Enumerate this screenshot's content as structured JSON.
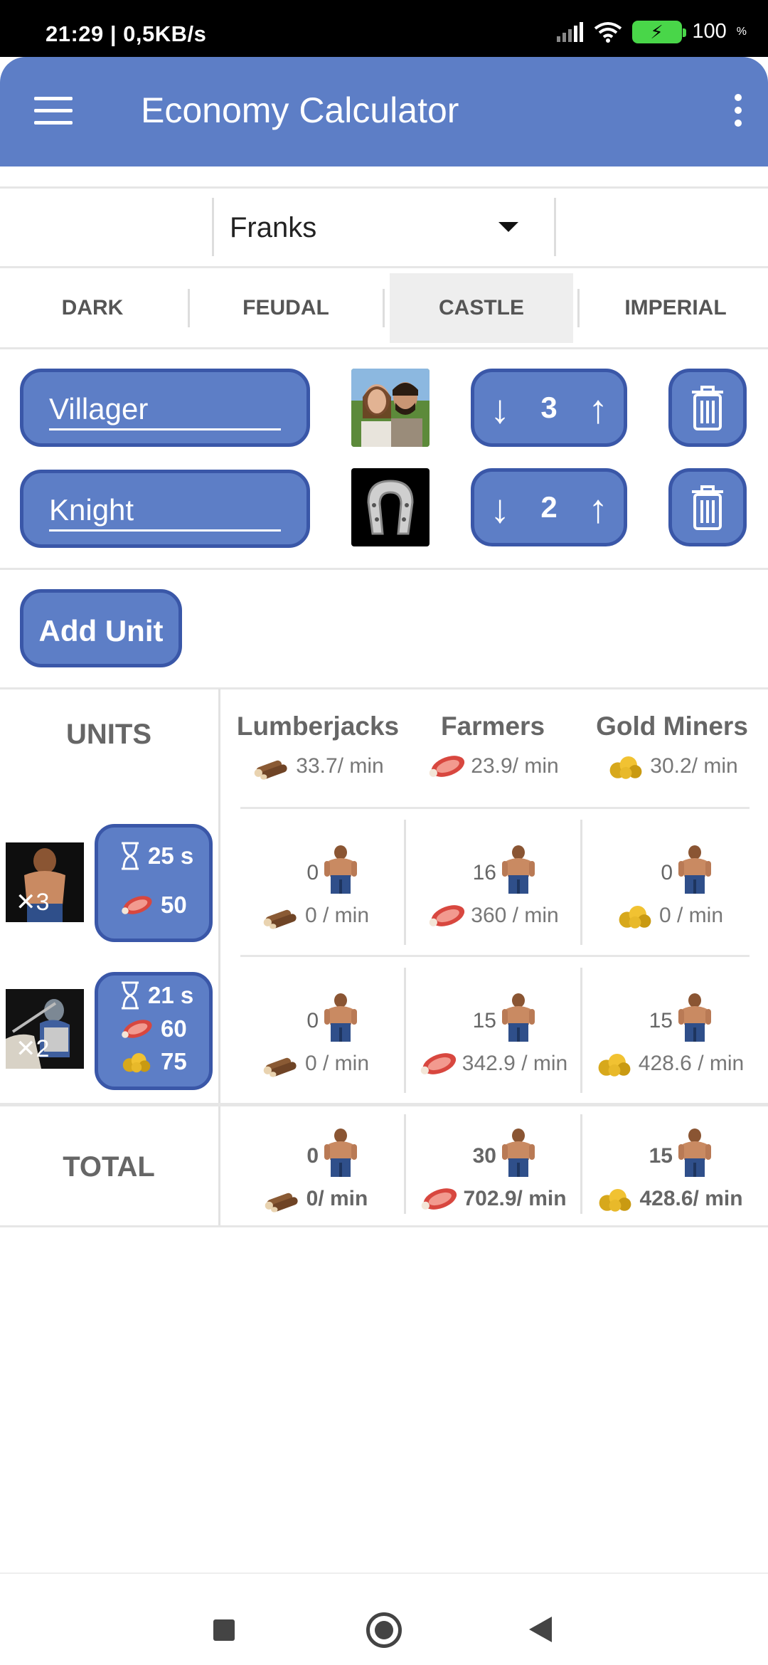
{
  "status_bar": {
    "time": "21:29 | 0,5KB/s",
    "battery": "100"
  },
  "app_bar": {
    "title": "Economy Calculator",
    "menu_icon": "hamburger-menu-icon",
    "overflow_icon": "more-vert-icon"
  },
  "civ_select": {
    "value": "Franks"
  },
  "age_tabs": [
    {
      "label": "DARK"
    },
    {
      "label": "FEUDAL"
    },
    {
      "label": "CASTLE",
      "selected": true
    },
    {
      "label": "IMPERIAL"
    }
  ],
  "unit_rows": [
    {
      "name": "Villager",
      "count": "3",
      "image": "villager-portrait"
    },
    {
      "name": "Knight",
      "count": "2",
      "image": "horseshoe-icon"
    }
  ],
  "add_unit_label": "Add Unit",
  "table": {
    "units_header": "UNITS",
    "columns": [
      {
        "name": "Lumberjacks",
        "rate": "33.7/ min",
        "resource": "wood"
      },
      {
        "name": "Farmers",
        "rate": "23.9/ min",
        "resource": "food"
      },
      {
        "name": "Gold Miners",
        "rate": "30.2/ min",
        "resource": "gold"
      }
    ],
    "rows": [
      {
        "multiplier": "3",
        "time": "25 s",
        "costs": [
          {
            "resource": "food",
            "amount": "50"
          }
        ],
        "cells": [
          {
            "count": "0",
            "rate": "0 / min"
          },
          {
            "count": "16",
            "rate": "360 / min"
          },
          {
            "count": "0",
            "rate": "0 / min"
          }
        ]
      },
      {
        "multiplier": "2",
        "time": "21 s",
        "costs": [
          {
            "resource": "food",
            "amount": "60"
          },
          {
            "resource": "gold",
            "amount": "75"
          }
        ],
        "cells": [
          {
            "count": "0",
            "rate": "0 / min"
          },
          {
            "count": "15",
            "rate": "342.9 / min"
          },
          {
            "count": "15",
            "rate": "428.6 / min"
          }
        ]
      }
    ],
    "total": {
      "label": "TOTAL",
      "cells": [
        {
          "count": "0",
          "rate": "0/ min"
        },
        {
          "count": "30",
          "rate": "702.9/ min"
        },
        {
          "count": "15",
          "rate": "428.6/ min"
        }
      ]
    }
  },
  "colors": {
    "accent": "#5d7ec6",
    "accent_border": "#3a57a8"
  }
}
